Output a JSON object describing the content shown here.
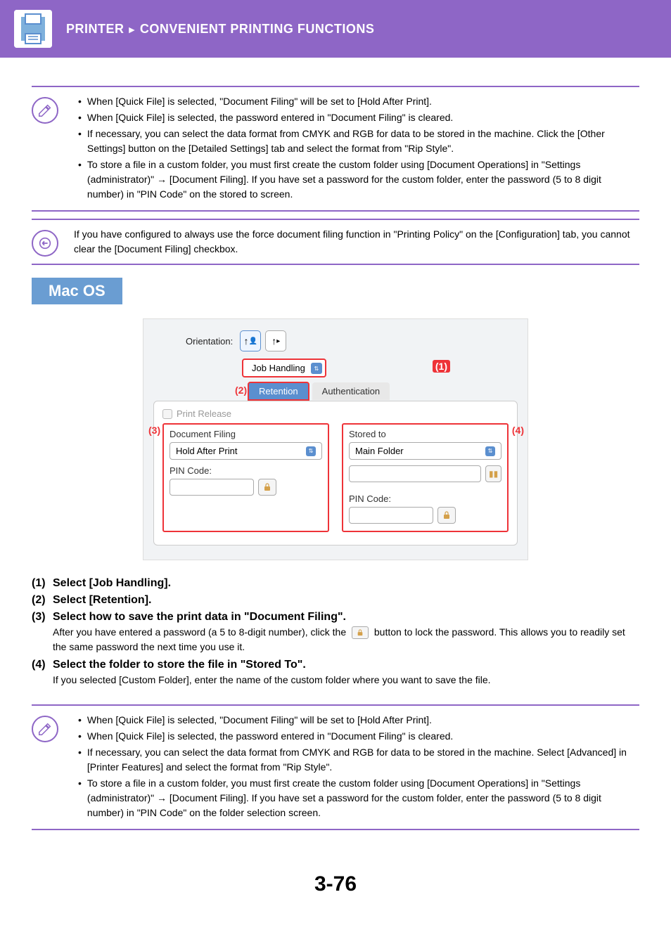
{
  "header": {
    "section": "PRINTER",
    "title": "CONVENIENT PRINTING FUNCTIONS"
  },
  "notes_top": {
    "b1": "When [Quick File] is selected, \"Document Filing\" will be set to [Hold After Print].",
    "b2": "When [Quick File] is selected, the password entered in \"Document Filing\" is cleared.",
    "b3": "If necessary, you can select the data format from CMYK and RGB for data to be stored in the machine. Click the [Other Settings] button on the [Detailed Settings] tab and select the format from \"Rip Style\".",
    "b4": "To store a file in a custom folder, you must first create the custom folder using [Document Operations] in \"Settings (administrator)\" → [Document Filing]. If you have set a password for the custom folder, enter the password (5 to 8 digit number) in \"PIN Code\" on the stored to screen."
  },
  "policy_note": "If you have configured to always use the force document filing function in \"Printing Policy\" on the [Configuration] tab, you cannot clear the [Document Filing] checkbox.",
  "os_badge": "Mac OS",
  "dialog": {
    "orientation_label": "Orientation:",
    "job_handling": "Job Handling",
    "tab_retention": "Retention",
    "tab_auth": "Authentication",
    "print_release": "Print Release",
    "doc_filing": "Document Filing",
    "hold_after": "Hold After Print",
    "pin_code": "PIN Code:",
    "stored_to": "Stored to",
    "main_folder": "Main Folder",
    "pin_code2": "PIN Code:",
    "callouts": {
      "c1": "(1)",
      "c2": "(2)",
      "c3": "(3)",
      "c4": "(4)"
    }
  },
  "steps": {
    "s1": {
      "num": "(1)",
      "title": "Select [Job Handling]."
    },
    "s2": {
      "num": "(2)",
      "title": "Select [Retention]."
    },
    "s3": {
      "num": "(3)",
      "title": "Select how to save the print data in \"Document Filing\".",
      "body_a": "After you have entered a password (a 5 to 8-digit number), click the ",
      "body_b": " button to lock the password. This allows you to readily set the same password the next time you use it."
    },
    "s4": {
      "num": "(4)",
      "title": "Select the folder to store the file in \"Stored To\".",
      "body": "If you selected [Custom Folder], enter the name of the custom folder where you want to save the file."
    }
  },
  "notes_bottom": {
    "b1": "When [Quick File] is selected, \"Document Filing\" will be set to [Hold After Print].",
    "b2": "When [Quick File] is selected, the password entered in \"Document Filing\" is cleared.",
    "b3": "If necessary, you can select the data format from CMYK and RGB for data to be stored in the machine. Select [Advanced] in [Printer Features] and select the format from \"Rip Style\".",
    "b4": "To store a file in a custom folder, you must first create the custom folder using [Document Operations] in \"Settings (administrator)\" → [Document Filing]. If you have set a password for the custom folder, enter the password (5 to 8 digit number) in \"PIN Code\" on the folder selection screen."
  },
  "page_number": "3-76"
}
